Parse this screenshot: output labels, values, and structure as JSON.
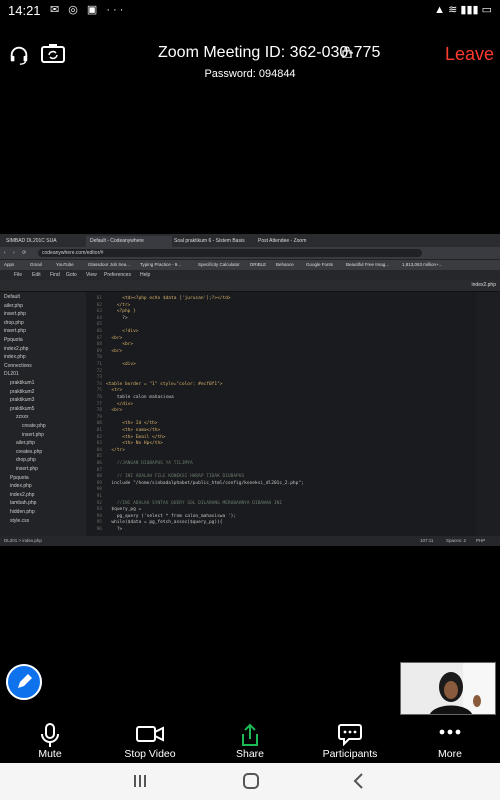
{
  "status_bar": {
    "time": "14:21",
    "icons": [
      "M",
      "instagram",
      "chat",
      "more"
    ],
    "right_icons": [
      "sim",
      "signal",
      "battery"
    ]
  },
  "meeting": {
    "title": "Zoom Meeting ID: 362-030-775",
    "password": "Password: 094844",
    "leave_label": "Leave"
  },
  "browser": {
    "tabs": [
      {
        "label": "SIMBAD DL201C SUA",
        "active": false
      },
      {
        "label": "Default - Codeanywhere",
        "active": true
      },
      {
        "label": "Soal praktikum 6 - Sistem Basis",
        "active": false
      },
      {
        "label": "Post Attendee - Zoom",
        "active": false
      }
    ],
    "url": "codeanywhere.com/editor/#",
    "bookmarks": [
      "Apps",
      "Gmail",
      "YouTube",
      "Glassdoor Job Sea...",
      "Typing Practice - 9...",
      "Specificity Calculator",
      "DRIBLE",
      "Behance",
      "Google Fonts",
      "Beautiful Free Imag...",
      "1,813,063 million+..."
    ]
  },
  "editor": {
    "menu": [
      "File",
      "Edit",
      "Find",
      "Goto",
      "View",
      "Preferences",
      "Help"
    ],
    "active_tab": "index2.php",
    "sidebar": [
      {
        "label": "Default",
        "depth": 0
      },
      {
        "label": "ailer.php",
        "depth": 0
      },
      {
        "label": "insert.php",
        "depth": 0
      },
      {
        "label": "drop.php",
        "depth": 0
      },
      {
        "label": "insert.php",
        "depth": 0
      },
      {
        "label": "Ppquota",
        "depth": 0
      },
      {
        "label": "index2.php",
        "depth": 0
      },
      {
        "label": "index.php",
        "depth": 0
      },
      {
        "label": "Connections",
        "depth": 0
      },
      {
        "label": "DL201",
        "depth": 0
      },
      {
        "label": "praktikum1",
        "depth": 1
      },
      {
        "label": "praktikum2",
        "depth": 1
      },
      {
        "label": "praktikum3",
        "depth": 1
      },
      {
        "label": "praktikum5",
        "depth": 1
      },
      {
        "label": "zzxxx",
        "depth": 2
      },
      {
        "label": "create.php",
        "depth": 3
      },
      {
        "label": "insert.php",
        "depth": 3
      },
      {
        "label": "ailer.php",
        "depth": 2
      },
      {
        "label": "creates.php",
        "depth": 2
      },
      {
        "label": "drop.php",
        "depth": 2
      },
      {
        "label": "insert.php",
        "depth": 2
      },
      {
        "label": "Ppquota",
        "depth": 1
      },
      {
        "label": "index.php",
        "depth": 1
      },
      {
        "label": "index2.php",
        "depth": 1
      },
      {
        "label": "tambah.php",
        "depth": 1
      },
      {
        "label": "hidden.php",
        "depth": 1
      },
      {
        "label": "style.css",
        "depth": 1
      }
    ],
    "code_lines": [
      {
        "n": "61",
        "text": "      <td><?php echo $data ['jurusan'];?></td>"
      },
      {
        "n": "62",
        "text": "    </tr>"
      },
      {
        "n": "63",
        "text": "    <?php }"
      },
      {
        "n": "64",
        "text": "      ?>"
      },
      {
        "n": "65",
        "text": ""
      },
      {
        "n": "66",
        "text": "      <!div>"
      },
      {
        "n": "67",
        "text": "  <br>"
      },
      {
        "n": "68",
        "text": "      <br>"
      },
      {
        "n": "69",
        "text": "  <br>"
      },
      {
        "n": "70",
        "text": ""
      },
      {
        "n": "71",
        "text": "      <div>"
      },
      {
        "n": "72",
        "text": ""
      },
      {
        "n": "73",
        "text": ""
      },
      {
        "n": "74",
        "text": "<table border = \"1\" style=\"color: #ecf0f1\">"
      },
      {
        "n": "75",
        "text": "  <tr>"
      },
      {
        "n": "76",
        "text": "    table calon mahasiswa"
      },
      {
        "n": "77",
        "text": "    </div>"
      },
      {
        "n": "78",
        "text": "  <br>"
      },
      {
        "n": "79",
        "text": ""
      },
      {
        "n": "80",
        "text": "      <th> Id </th>"
      },
      {
        "n": "81",
        "text": "      <th> nama</th>"
      },
      {
        "n": "82",
        "text": "      <th> Email </th>"
      },
      {
        "n": "83",
        "text": "      <th> No Hp</th>"
      },
      {
        "n": "84",
        "text": "  </tr>"
      },
      {
        "n": "85",
        "text": ""
      },
      {
        "n": "86",
        "text": "    //JANGAN DIUBAPUS YA TILIMYA"
      },
      {
        "n": "87",
        "text": ""
      },
      {
        "n": "88",
        "text": "    // INI ADALAH FILE KONEKSI HARAP TIDAK DIUBAPUS"
      },
      {
        "n": "89",
        "text": "  include \"/home/sinbadalphabet/public_html/config/koneksi_dl201c_2.php\";"
      },
      {
        "n": "90",
        "text": ""
      },
      {
        "n": "91",
        "text": ""
      },
      {
        "n": "92",
        "text": "    //INI ADALAH SYNTAX QUERY SQL DILARANG MERUBAHNYA DIBAWAH INI"
      },
      {
        "n": "93",
        "text": "  $query_pg = "
      },
      {
        "n": "94",
        "text": "    pg_query ('select * from calon_mahasiswa ');"
      },
      {
        "n": "95",
        "text": "  while($data = pg_fetch_assoc($query_pg)){"
      },
      {
        "n": "96",
        "text": "    ?>"
      }
    ],
    "status": {
      "path": "DL201 > index.php",
      "position": "107:11",
      "spaces": "Spaces: 2",
      "lang": "PHP"
    }
  },
  "controls": [
    {
      "label": "Mute",
      "icon": "microphone-icon"
    },
    {
      "label": "Stop Video",
      "icon": "video-camera-icon"
    },
    {
      "label": "Share",
      "icon": "share-icon"
    },
    {
      "label": "Participants",
      "icon": "participants-icon"
    },
    {
      "label": "More",
      "icon": "more-icon"
    }
  ],
  "colors": {
    "leave": "#ff3b30",
    "share_green": "#1db954",
    "annotate_blue": "#0e72ed"
  }
}
